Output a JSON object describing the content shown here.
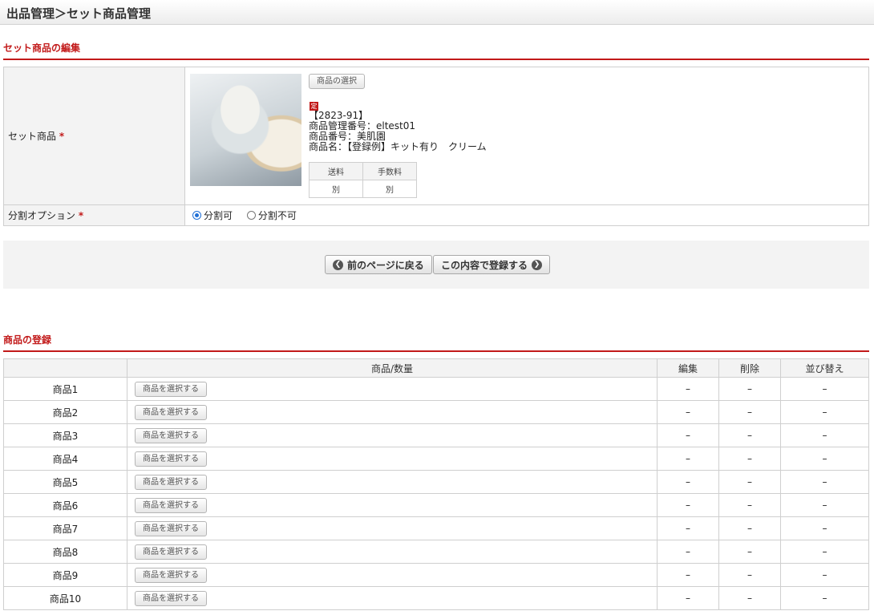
{
  "header": {
    "title": "出品管理＞セット商品管理"
  },
  "edit_section": {
    "title": "セット商品の編集",
    "set_product_label": "セット商品",
    "required_mark": "*",
    "select_button": "商品の選択",
    "tag": "定",
    "product": {
      "code": "【2823-91】",
      "management_no": "商品管理番号：eltest01",
      "product_no": "商品番号：美肌園",
      "name": "商品名：【登録例】キット有り　クリーム"
    },
    "fees": {
      "headers": [
        "送料",
        "手数料"
      ],
      "values": [
        "別",
        "別"
      ]
    },
    "split_option_label": "分割オプション",
    "split_options": [
      {
        "label": "分割可",
        "selected": true
      },
      {
        "label": "分割不可",
        "selected": false
      }
    ]
  },
  "actions": {
    "back_label": "前のページに戻る",
    "submit_label": "この内容で登録する"
  },
  "register_section": {
    "title": "商品の登録",
    "columns": [
      "",
      "商品/数量",
      "編集",
      "削除",
      "並び替え"
    ],
    "select_label": "商品を選択する",
    "dash": "–",
    "rows": [
      "商品1",
      "商品2",
      "商品3",
      "商品4",
      "商品5",
      "商品6",
      "商品7",
      "商品8",
      "商品9",
      "商品10"
    ]
  }
}
